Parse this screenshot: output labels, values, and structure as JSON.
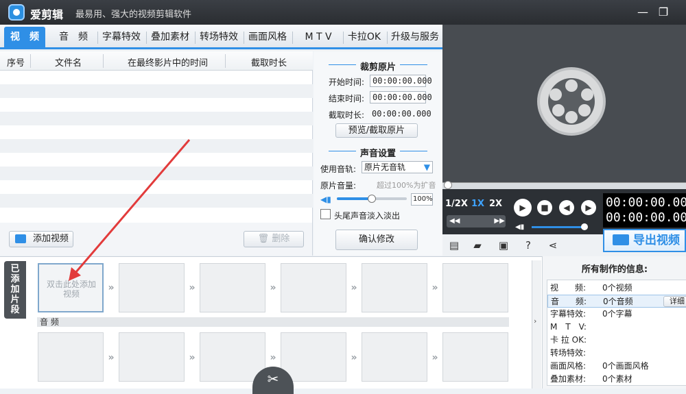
{
  "app": {
    "title": "爱剪辑",
    "slogan": "最易用、强大的视频剪辑软件",
    "minimize_icon": "minimize-icon",
    "maximize_icon": "maximize-icon"
  },
  "tabs": [
    {
      "label": "视　频",
      "active": true
    },
    {
      "label": "音　频"
    },
    {
      "label": "字幕特效"
    },
    {
      "label": "叠加素材"
    },
    {
      "label": "转场特效"
    },
    {
      "label": "画面风格"
    },
    {
      "label": "M T V"
    },
    {
      "label": "卡拉OK"
    },
    {
      "label": "升级与服务"
    }
  ],
  "clip_table": {
    "columns": [
      "序号",
      "文件名",
      "在最终影片中的时间",
      "截取时长"
    ],
    "rows": []
  },
  "clip_actions": {
    "add_video": "添加视频",
    "delete": "删除"
  },
  "trim": {
    "title": "裁剪原片",
    "start_label": "开始时间:",
    "start_value": "00:00:00.000",
    "end_label": "结束时间:",
    "end_value": "00:00:00.000",
    "duration_label": "截取时长:",
    "duration_value": "00:00:00.000",
    "preview_button": "预览/截取原片"
  },
  "sound": {
    "title": "声音设置",
    "track_label": "使用音轨:",
    "track_value": "原片无音轨",
    "volume_label": "原片音量:",
    "volume_hint": "超过100%为扩音",
    "volume_value": "100%",
    "volume_level": 0.5,
    "fade_label": "头尾声音淡入淡出",
    "confirm_button": "确认修改"
  },
  "player": {
    "speeds": [
      "1/2X",
      "1X",
      "2X"
    ],
    "active_speed": "1X",
    "timecode_current": "00:00:00.000",
    "timecode_total": "00:00:00.000",
    "export_button": "导出视频"
  },
  "timeline": {
    "added_tab": "已添加片段",
    "first_slot_hint": "双击此处添加视频",
    "audio_label": "音 频",
    "slot_count": 6
  },
  "info": {
    "title": "所有制作的信息:",
    "detail_button": "详细",
    "items": [
      {
        "key": "视　　频:",
        "value": "0个视频"
      },
      {
        "key": "音　　频:",
        "value": "0个音频"
      },
      {
        "key": "字幕特效:",
        "value": "0个字幕"
      },
      {
        "key": "M　T　V:",
        "value": ""
      },
      {
        "key": "卡 拉 OK:",
        "value": ""
      },
      {
        "key": "转场特效:",
        "value": ""
      },
      {
        "key": "画面风格:",
        "value": "0个画面风格"
      },
      {
        "key": "叠加素材:",
        "value": "0个素材"
      }
    ]
  },
  "colors": {
    "accent": "#2f8fe6",
    "titlebar": "#2a2d31",
    "annotation_arrow": "#e23b3b"
  }
}
